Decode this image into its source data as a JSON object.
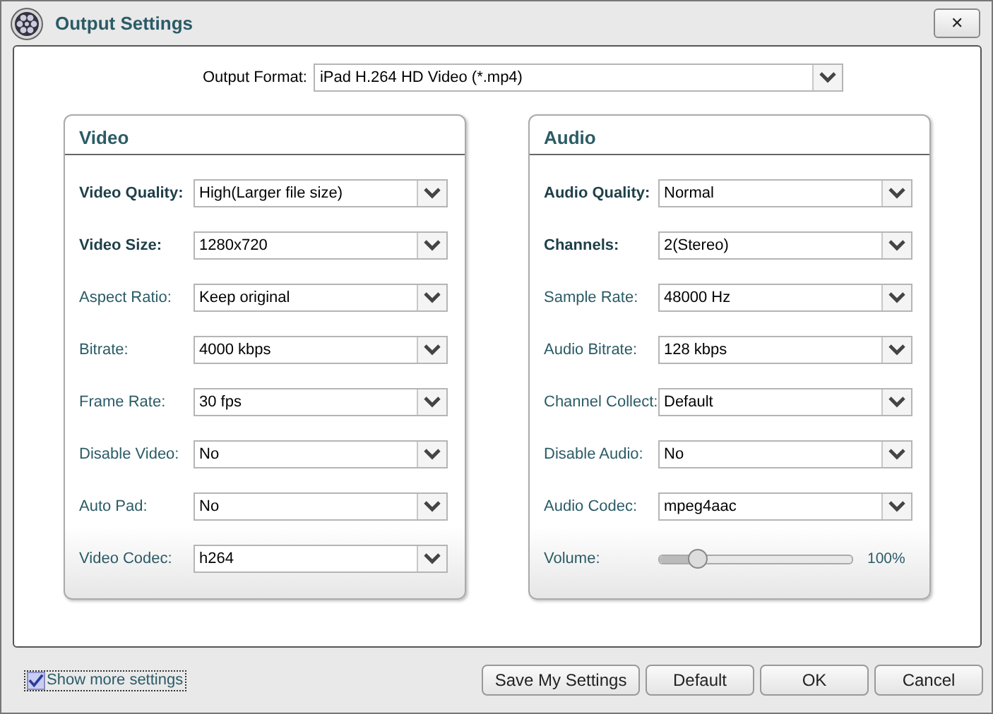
{
  "window": {
    "title": "Output Settings",
    "close": "✕"
  },
  "output_format": {
    "label": "Output Format:",
    "value": "iPad H.264 HD Video (*.mp4)"
  },
  "panels": [
    {
      "title": "Video",
      "rows": [
        {
          "kind": "select",
          "label": "Video Quality:",
          "bold": true,
          "value": "High(Larger file size)"
        },
        {
          "kind": "select",
          "label": "Video Size:",
          "bold": true,
          "value": "1280x720"
        },
        {
          "kind": "select",
          "label": "Aspect Ratio:",
          "bold": false,
          "value": "Keep original"
        },
        {
          "kind": "select",
          "label": "Bitrate:",
          "bold": false,
          "value": "4000 kbps"
        },
        {
          "kind": "select",
          "label": "Frame Rate:",
          "bold": false,
          "value": "30 fps"
        },
        {
          "kind": "select",
          "label": "Disable Video:",
          "bold": false,
          "value": "No"
        },
        {
          "kind": "select",
          "label": "Auto Pad:",
          "bold": false,
          "value": "No"
        },
        {
          "kind": "select",
          "label": "Video Codec:",
          "bold": false,
          "value": "h264"
        }
      ]
    },
    {
      "title": "Audio",
      "rows": [
        {
          "kind": "select",
          "label": "Audio Quality:",
          "bold": true,
          "value": "Normal"
        },
        {
          "kind": "select",
          "label": "Channels:",
          "bold": true,
          "value": "2(Stereo)"
        },
        {
          "kind": "select",
          "label": "Sample Rate:",
          "bold": false,
          "value": "48000 Hz"
        },
        {
          "kind": "select",
          "label": "Audio Bitrate:",
          "bold": false,
          "value": "128 kbps"
        },
        {
          "kind": "select",
          "label": "Channel Collect:",
          "bold": false,
          "value": "Default"
        },
        {
          "kind": "select",
          "label": "Disable Audio:",
          "bold": false,
          "value": "No"
        },
        {
          "kind": "select",
          "label": "Audio Codec:",
          "bold": false,
          "value": "mpeg4aac"
        },
        {
          "kind": "slider",
          "label": "Volume:",
          "bold": false,
          "level": 0.2,
          "reading": "100%"
        }
      ]
    }
  ],
  "show_more": {
    "label": "Show more settings",
    "checked": true
  },
  "buttons": [
    "Save My Settings",
    "Default",
    "OK",
    "Cancel"
  ]
}
